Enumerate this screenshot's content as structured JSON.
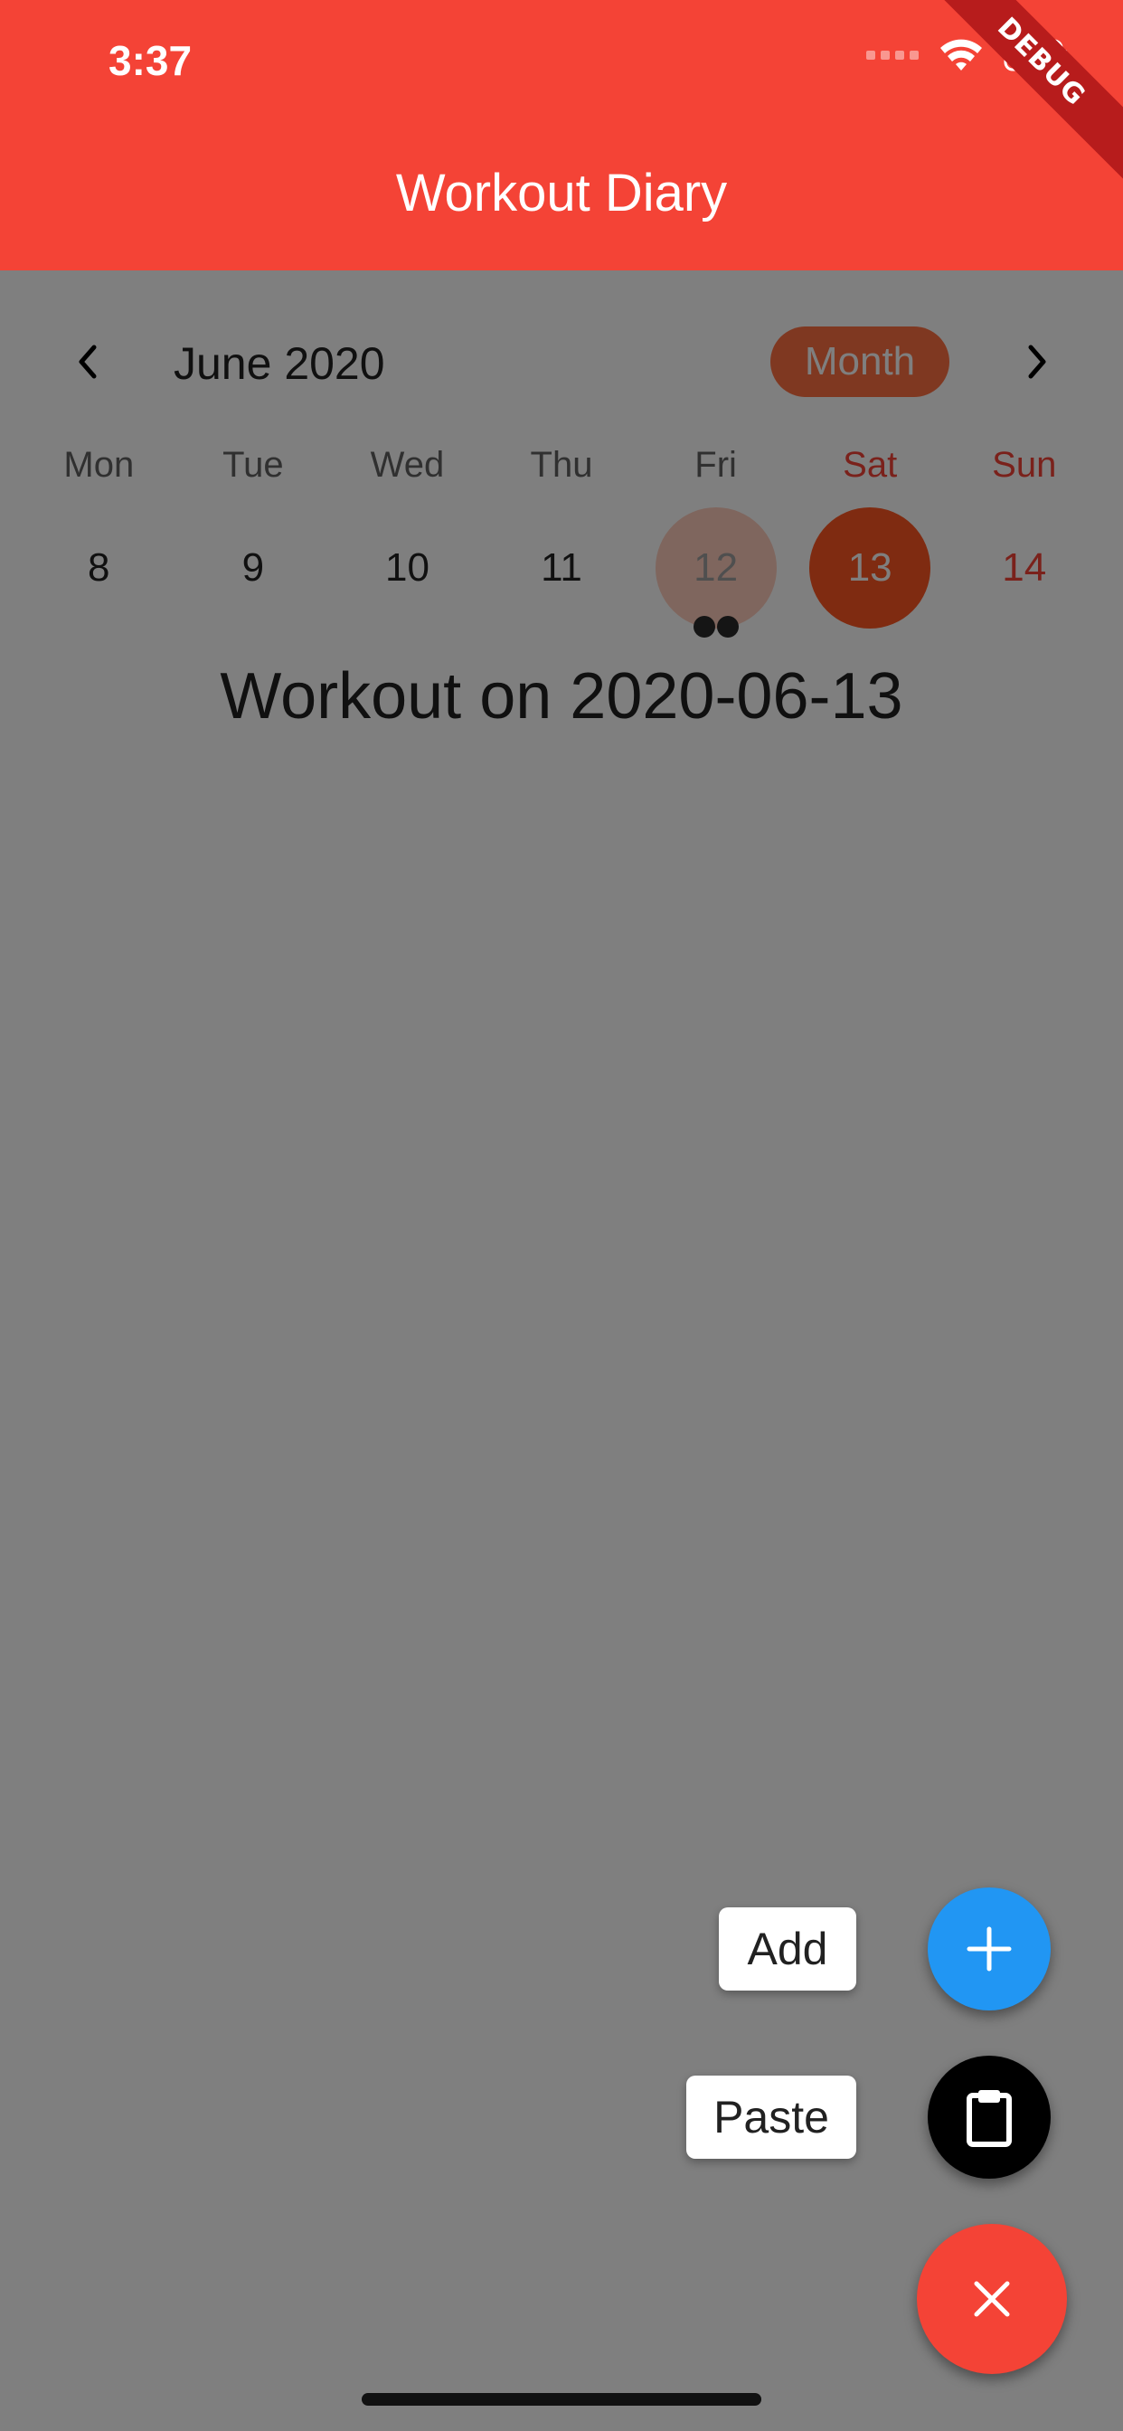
{
  "status_bar": {
    "time": "3:37"
  },
  "app_bar": {
    "title": "Workout Diary"
  },
  "debug_banner": "DEBUG",
  "calendar": {
    "month_label": "June 2020",
    "format_button": "Month",
    "weekdays": [
      "Mon",
      "Tue",
      "Wed",
      "Thu",
      "Fri",
      "Sat",
      "Sun"
    ],
    "days": [
      "8",
      "9",
      "10",
      "11",
      "12",
      "13",
      "14"
    ],
    "today": "12",
    "selected": "13",
    "event_markers_day": "12",
    "event_marker_count": 2
  },
  "workout_title": "Workout on 2020-06-13",
  "speed_dial": {
    "add_label": "Add",
    "paste_label": "Paste",
    "add_icon": "plus-icon",
    "paste_icon": "clipboard-icon",
    "close_icon": "close-icon"
  },
  "colors": {
    "primary": "#F44336",
    "selected_day": "#FF5722",
    "today_day": "#FFCCBC",
    "add_fab": "#2196F3",
    "paste_fab": "#000000",
    "overlay": "rgba(0,0,0,0.5)"
  }
}
